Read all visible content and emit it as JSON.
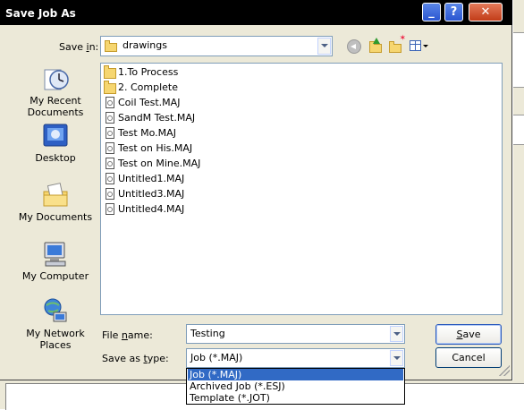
{
  "dialog": {
    "title": "Save Job As",
    "controls": {
      "minimize": "_",
      "help": "?",
      "close": "✕"
    }
  },
  "save_in": {
    "label_pre": "Save ",
    "label_accel": "i",
    "label_post": "n:",
    "folder": "drawings"
  },
  "places": [
    {
      "label": "My Recent Documents",
      "icon": "recent-documents-icon"
    },
    {
      "label": "Desktop",
      "icon": "desktop-icon"
    },
    {
      "label": "My Documents",
      "icon": "my-documents-icon"
    },
    {
      "label": "My Computer",
      "icon": "my-computer-icon"
    },
    {
      "label": "My Network Places",
      "icon": "network-places-icon"
    }
  ],
  "files": [
    {
      "name": "1.To Process",
      "type": "folder"
    },
    {
      "name": "2. Complete",
      "type": "folder"
    },
    {
      "name": "Coil Test.MAJ",
      "type": "file"
    },
    {
      "name": "SandM Test.MAJ",
      "type": "file"
    },
    {
      "name": "Test Mo.MAJ",
      "type": "file"
    },
    {
      "name": "Test on His.MAJ",
      "type": "file"
    },
    {
      "name": "Test on Mine.MAJ",
      "type": "file"
    },
    {
      "name": "Untitled1.MAJ",
      "type": "file"
    },
    {
      "name": "Untitled3.MAJ",
      "type": "file"
    },
    {
      "name": "Untitled4.MAJ",
      "type": "file"
    }
  ],
  "file_name": {
    "label_pre": "File ",
    "label_accel": "n",
    "label_post": "ame:",
    "value": "Testing"
  },
  "save_as_type": {
    "label_pre": "Save as ",
    "label_accel": "t",
    "label_post": "ype:",
    "value": "Job (*.MAJ)",
    "options": [
      "Job (*.MAJ)",
      "Archived Job (*.ESJ)",
      "Template (*.JOT)"
    ],
    "selected_index": 0
  },
  "buttons": {
    "save_accel": "S",
    "save_rest": "ave",
    "cancel": "Cancel"
  },
  "colors": {
    "title_bar": "#000000",
    "selection": "#316ac5",
    "dialog_bg": "#ece9d8"
  }
}
